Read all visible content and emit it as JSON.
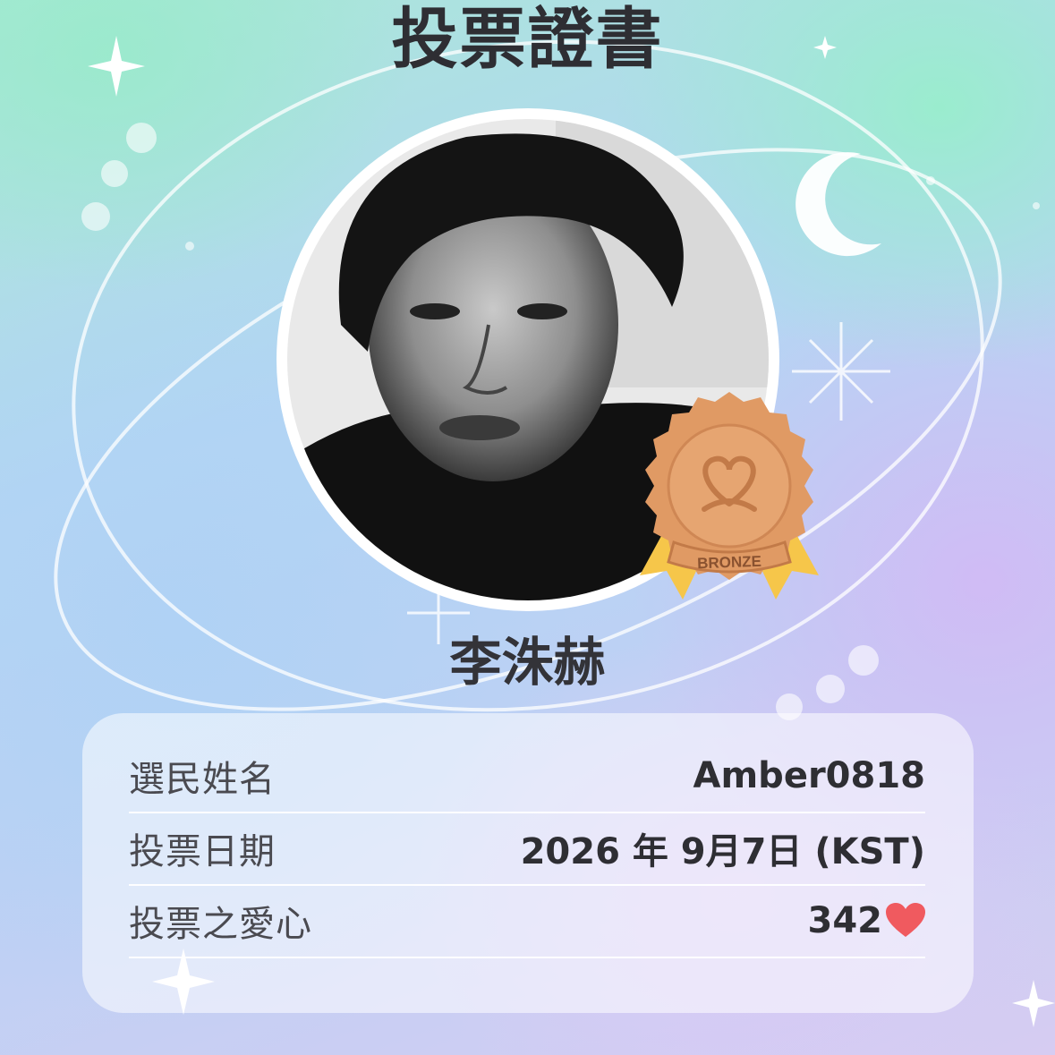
{
  "certificate": {
    "title": "投票證書",
    "idol_name": "李洙赫",
    "badge": {
      "tier": "BRONZE",
      "medal_color": "#e09a64",
      "ribbon_color": "#f6c64a"
    }
  },
  "details": {
    "voter_label": "選民姓名",
    "voter_value": "Amber0818",
    "date_label": "投票日期",
    "date_value": "2026 年 9月7日 (KST)",
    "hearts_label": "投票之愛心",
    "hearts_value": "342",
    "hearts_icon": "heart-icon",
    "heart_color": "#f05a5f"
  }
}
